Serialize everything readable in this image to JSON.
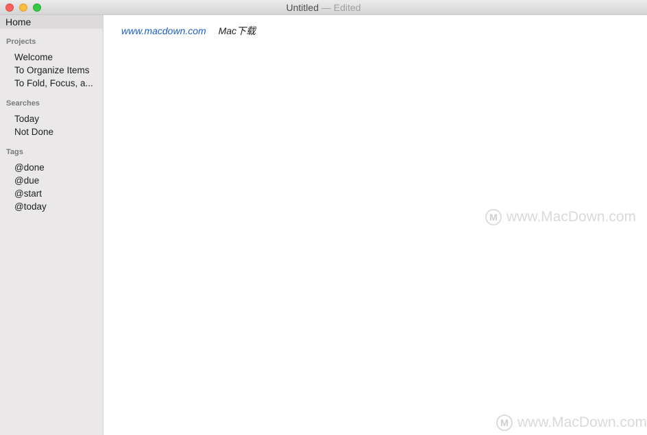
{
  "window": {
    "title": "Untitled",
    "separator": "—",
    "status": "Edited"
  },
  "sidebar": {
    "home": "Home",
    "projects_header": "Projects",
    "projects": [
      "Welcome",
      "To Organize Items",
      "To Fold, Focus, a..."
    ],
    "searches_header": "Searches",
    "searches": [
      "Today",
      "Not Done"
    ],
    "tags_header": "Tags",
    "tags": [
      "@done",
      "@due",
      "@start",
      "@today"
    ]
  },
  "editor": {
    "url_text": "www.macdown.com",
    "label_text": "Mac下载"
  },
  "watermark": {
    "text": "www.MacDown.com"
  },
  "colors": {
    "link": "#1d5fc0",
    "sidebar_bg": "#eae8e8",
    "close": "#fc605c",
    "minimize": "#fdbc40",
    "maximize": "#34c84a"
  }
}
